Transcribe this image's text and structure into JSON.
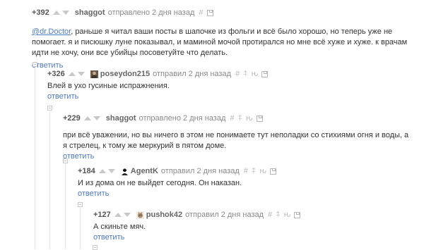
{
  "comments": [
    {
      "rating": "+392",
      "nick": "shaggot",
      "time": "отправлено 2 дня назад",
      "mention": "@dr.Doctor",
      "text": ", раньше я читал ваши посты в шапочке из фольги и всё было хорошо, но теперь уже не помогает. я и писюшку луне показывал, и маминой мочой протирался но мне всё хуже и хуже. к врачам идти не хочу, они все убийцы посоветуйте что делать.",
      "reply": "ответить"
    },
    {
      "rating": "+326",
      "nick": "poseydon215",
      "time": "отправил 2 дня назад",
      "text": "Влей в ухо гусиные испражнения.",
      "reply": "ответить"
    },
    {
      "rating": "+229",
      "nick": "shaggot",
      "time": "отправлено 2 дня назад",
      "text": "при всё уважении, но вы ничего в этом не понимаете тут неполадки со стихиями огня и воды, а я стрелец, к тому же меркурий в пятом доме.",
      "reply": "ответить"
    },
    {
      "rating": "+184",
      "nick": "AgentK",
      "time": "отправил 2 дня назад",
      "text": "И из дома он не выйдет сегодня. Он наказан.",
      "reply": "ответить"
    },
    {
      "rating": "+127",
      "nick": "pushok42",
      "time": "отправил 2 дня назад",
      "text": "А скиньте мяч.",
      "reply": "ответить"
    }
  ],
  "tools": {
    "hash": "#",
    "pin": "⍏",
    "branch": "ԋ"
  },
  "icons": {
    "up": "arrow-up-icon",
    "down": "arrow-down-icon",
    "save": "save-icon",
    "collapse": "collapse-icon"
  },
  "colors": {
    "link": "#4f7ab8",
    "muted": "#8a8a8a",
    "arrow": "#c8c8c8"
  }
}
